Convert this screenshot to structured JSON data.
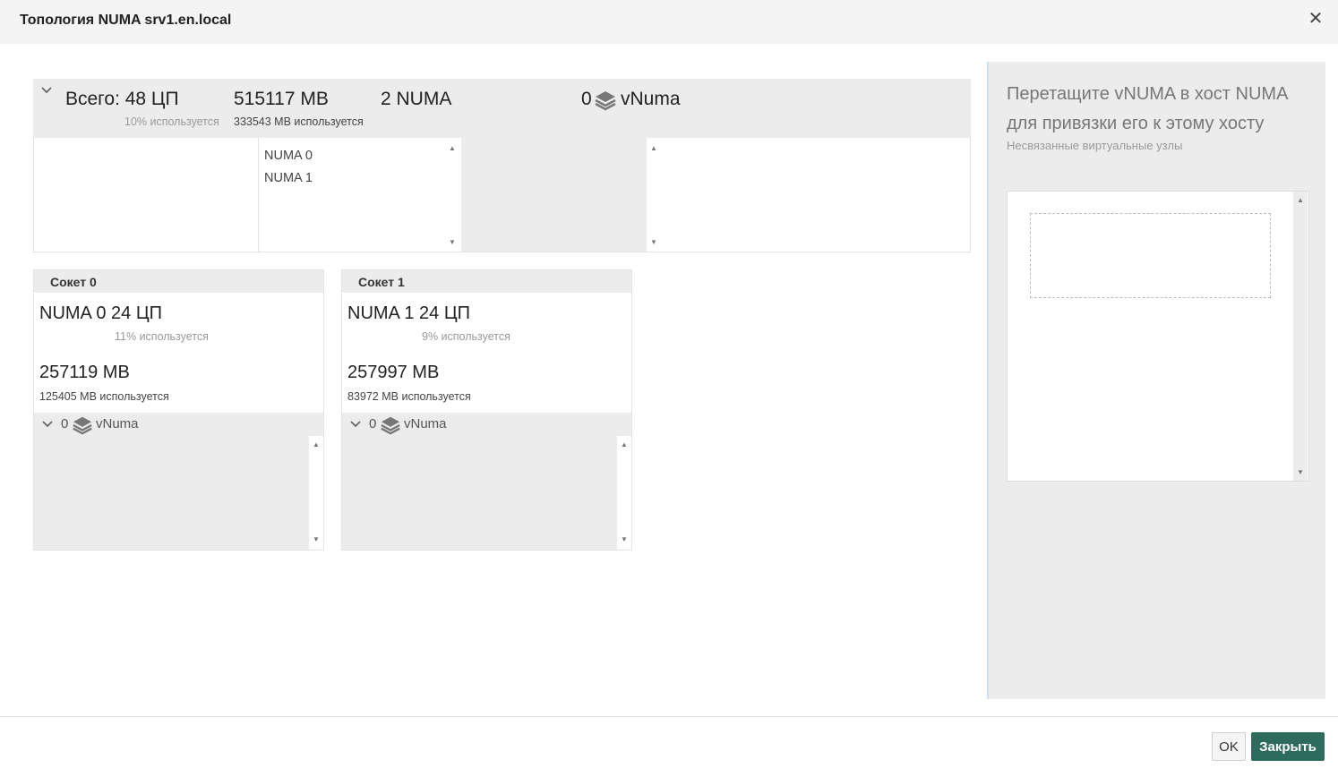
{
  "dialog": {
    "title": "Топология NUMA srv1.en.local"
  },
  "summary": {
    "cpu_total": "Всего: 48 ЦП",
    "cpu_usage": "10% используется",
    "memory_total": "515117 MB",
    "memory_usage": "333543 MB используется",
    "numa_count": "2 NUMA",
    "vnuma_count": "0",
    "vnuma_label": "vNuma",
    "numa_list": [
      "NUMA 0",
      "NUMA 1"
    ]
  },
  "sockets": [
    {
      "header": "Сокет 0",
      "numa_cpu": "NUMA 0 24 ЦП",
      "cpu_usage": "11% используется",
      "memory": "257119 MB",
      "memory_usage": "125405 MB используется",
      "vnuma_count": "0",
      "vnuma_label": "vNuma"
    },
    {
      "header": "Сокет 1",
      "numa_cpu": "NUMA 1 24 ЦП",
      "cpu_usage": "9% используется",
      "memory": "257997 MB",
      "memory_usage": "83972 MB используется",
      "vnuma_count": "0",
      "vnuma_label": "vNuma"
    }
  ],
  "unbound_panel": {
    "title": "Перетащите vNUMA в хост NUMA для привязки его к этому хосту",
    "subtitle": "Несвязанные виртуальные узлы"
  },
  "footer": {
    "ok_label": "OK",
    "close_label": "Закрыть"
  },
  "icons": {
    "close": "close-icon",
    "collapse": "chevron-down-icon",
    "vnuma": "layers-icon",
    "scroll_up": "arrow-up-icon",
    "scroll_down": "arrow-down-icon"
  },
  "colors": {
    "primary_button": "#2e6b5c",
    "panel_background": "#ececec",
    "header_background": "#f4f4f4"
  }
}
